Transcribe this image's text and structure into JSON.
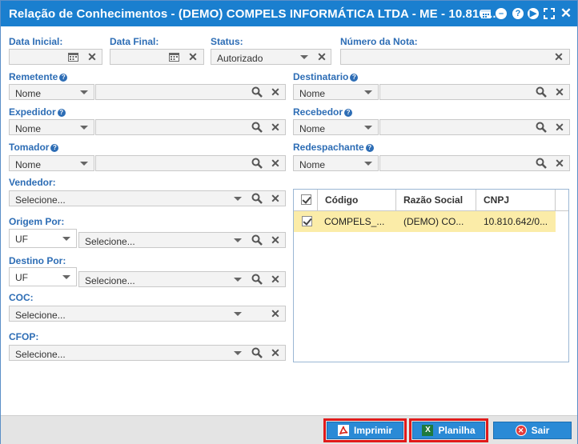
{
  "window": {
    "title": "Relação de Conhecimentos - (DEMO) COMPELS INFORMÁTICA LTDA - ME - 10.810...."
  },
  "filters": {
    "data_inicial_label": "Data Inicial:",
    "data_inicial_value": "",
    "data_final_label": "Data Final:",
    "data_final_value": "",
    "status_label": "Status:",
    "status_value": "Autorizado",
    "numero_nota_label": "Número da Nota:",
    "numero_nota_value": "",
    "remetente_label": "Remetente",
    "remetente_type": "Nome",
    "destinatario_label": "Destinatario",
    "destinatario_type": "Nome",
    "expedidor_label": "Expedidor",
    "expedidor_type": "Nome",
    "recebedor_label": "Recebedor",
    "recebedor_type": "Nome",
    "tomador_label": "Tomador",
    "tomador_type": "Nome",
    "redespachante_label": "Redespachante",
    "redespachante_type": "Nome",
    "vendedor_label": "Vendedor:",
    "vendedor_placeholder": "Selecione...",
    "origem_label": "Origem Por:",
    "origem_type": "UF",
    "origem_placeholder": "Selecione...",
    "destino_label": "Destino Por:",
    "destino_type": "UF",
    "destino_placeholder": "Selecione...",
    "coc_label": "COC:",
    "coc_placeholder": "Selecione...",
    "cfop_label": "CFOP:",
    "cfop_placeholder": "Selecione..."
  },
  "grid": {
    "columns": [
      "Código",
      "Razão Social",
      "CNPJ"
    ],
    "rows": [
      {
        "codigo": "COMPELS_...",
        "razao": "(DEMO) CO...",
        "cnpj": "10.810.642/0..."
      }
    ]
  },
  "buttons": {
    "imprimir": "Imprimir",
    "planilha": "Planilha",
    "sair": "Sair"
  },
  "colors": {
    "titlebar": "#1a7fcf",
    "label": "#2d6db5",
    "highlight": "#e01a1a",
    "row_selected": "#fbeca8"
  }
}
